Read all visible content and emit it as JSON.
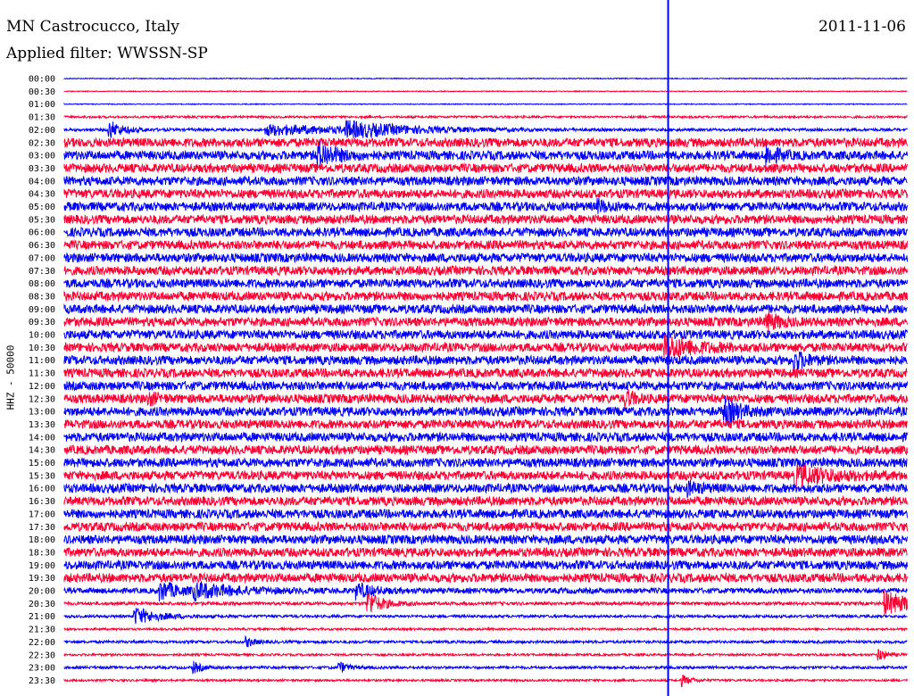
{
  "header": {
    "station": "MN Castrocucco, Italy",
    "date": "2011-11-06",
    "filter": "Applied filter: WWSSN-SP"
  },
  "chart_data": {
    "type": "line",
    "title": "MN Castrocucco, Italy",
    "ylabel": "HHZ - 50000",
    "grid": false,
    "colors": {
      "even_trace": "#0000ff",
      "odd_trace": "#ff0033",
      "marker": "#0000ff"
    },
    "time_labels": [
      "00:00",
      "00:30",
      "01:00",
      "01:30",
      "02:00",
      "02:30",
      "03:00",
      "03:30",
      "04:00",
      "04:30",
      "05:00",
      "05:30",
      "06:00",
      "06:30",
      "07:00",
      "07:30",
      "08:00",
      "08:30",
      "09:00",
      "09:30",
      "10:00",
      "10:30",
      "11:00",
      "11:30",
      "12:00",
      "12:30",
      "13:00",
      "13:30",
      "14:00",
      "14:30",
      "15:00",
      "15:30",
      "16:00",
      "16:30",
      "17:00",
      "17:30",
      "18:00",
      "18:30",
      "19:00",
      "19:30",
      "20:00",
      "20:30",
      "21:00",
      "21:30",
      "22:00",
      "22:30",
      "23:00",
      "23:30"
    ],
    "noise_level": [
      0.5,
      0.5,
      0.5,
      1.2,
      1.5,
      5,
      5,
      5,
      5,
      5,
      5,
      5,
      5,
      5,
      5,
      5,
      5,
      5,
      5,
      5,
      5,
      5,
      5,
      5,
      5,
      5,
      5,
      5,
      5,
      5,
      5,
      5,
      5,
      5,
      5,
      5,
      5,
      5,
      5,
      5,
      3,
      1.8,
      1.5,
      1.2,
      1.5,
      1.2,
      1.5,
      1.2
    ],
    "marker_minute": 21.5,
    "events": [
      {
        "trace": 4,
        "minute": 1.6,
        "amp": 10,
        "decay": 0.5
      },
      {
        "trace": 4,
        "minute": 7.2,
        "amp": 6,
        "decay": 3
      },
      {
        "trace": 4,
        "minute": 10.0,
        "amp": 8,
        "decay": 2
      },
      {
        "trace": 6,
        "minute": 9.0,
        "amp": 14,
        "decay": 0.6
      },
      {
        "trace": 6,
        "minute": 25.0,
        "amp": 10,
        "decay": 0.4
      },
      {
        "trace": 10,
        "minute": 19.0,
        "amp": 5,
        "decay": 0.4
      },
      {
        "trace": 19,
        "minute": 25.0,
        "amp": 10,
        "decay": 0.4
      },
      {
        "trace": 21,
        "minute": 21.4,
        "amp": 12,
        "decay": 1.0
      },
      {
        "trace": 22,
        "minute": 26.0,
        "amp": 10,
        "decay": 0.4
      },
      {
        "trace": 25,
        "minute": 3.0,
        "amp": 6,
        "decay": 0.3
      },
      {
        "trace": 25,
        "minute": 20.0,
        "amp": 8,
        "decay": 0.3
      },
      {
        "trace": 26,
        "minute": 23.5,
        "amp": 14,
        "decay": 0.5
      },
      {
        "trace": 31,
        "minute": 26.0,
        "amp": 10,
        "decay": 1.2
      },
      {
        "trace": 32,
        "minute": 22.2,
        "amp": 6,
        "decay": 0.4
      },
      {
        "trace": 40,
        "minute": 3.4,
        "amp": 11,
        "decay": 0.6
      },
      {
        "trace": 40,
        "minute": 4.6,
        "amp": 8,
        "decay": 1.5
      },
      {
        "trace": 40,
        "minute": 10.4,
        "amp": 8,
        "decay": 0.6
      },
      {
        "trace": 41,
        "minute": 10.8,
        "amp": 14,
        "decay": 0.5
      },
      {
        "trace": 41,
        "minute": 29.2,
        "amp": 14,
        "decay": 1.0
      },
      {
        "trace": 42,
        "minute": 2.5,
        "amp": 10,
        "decay": 0.8
      },
      {
        "trace": 44,
        "minute": 6.5,
        "amp": 5,
        "decay": 0.3
      },
      {
        "trace": 45,
        "minute": 29.0,
        "amp": 7,
        "decay": 0.3
      },
      {
        "trace": 46,
        "minute": 4.6,
        "amp": 6,
        "decay": 0.3
      },
      {
        "trace": 46,
        "minute": 9.8,
        "amp": 6,
        "decay": 0.3
      },
      {
        "trace": 47,
        "minute": 22.0,
        "amp": 6,
        "decay": 0.3
      }
    ]
  }
}
